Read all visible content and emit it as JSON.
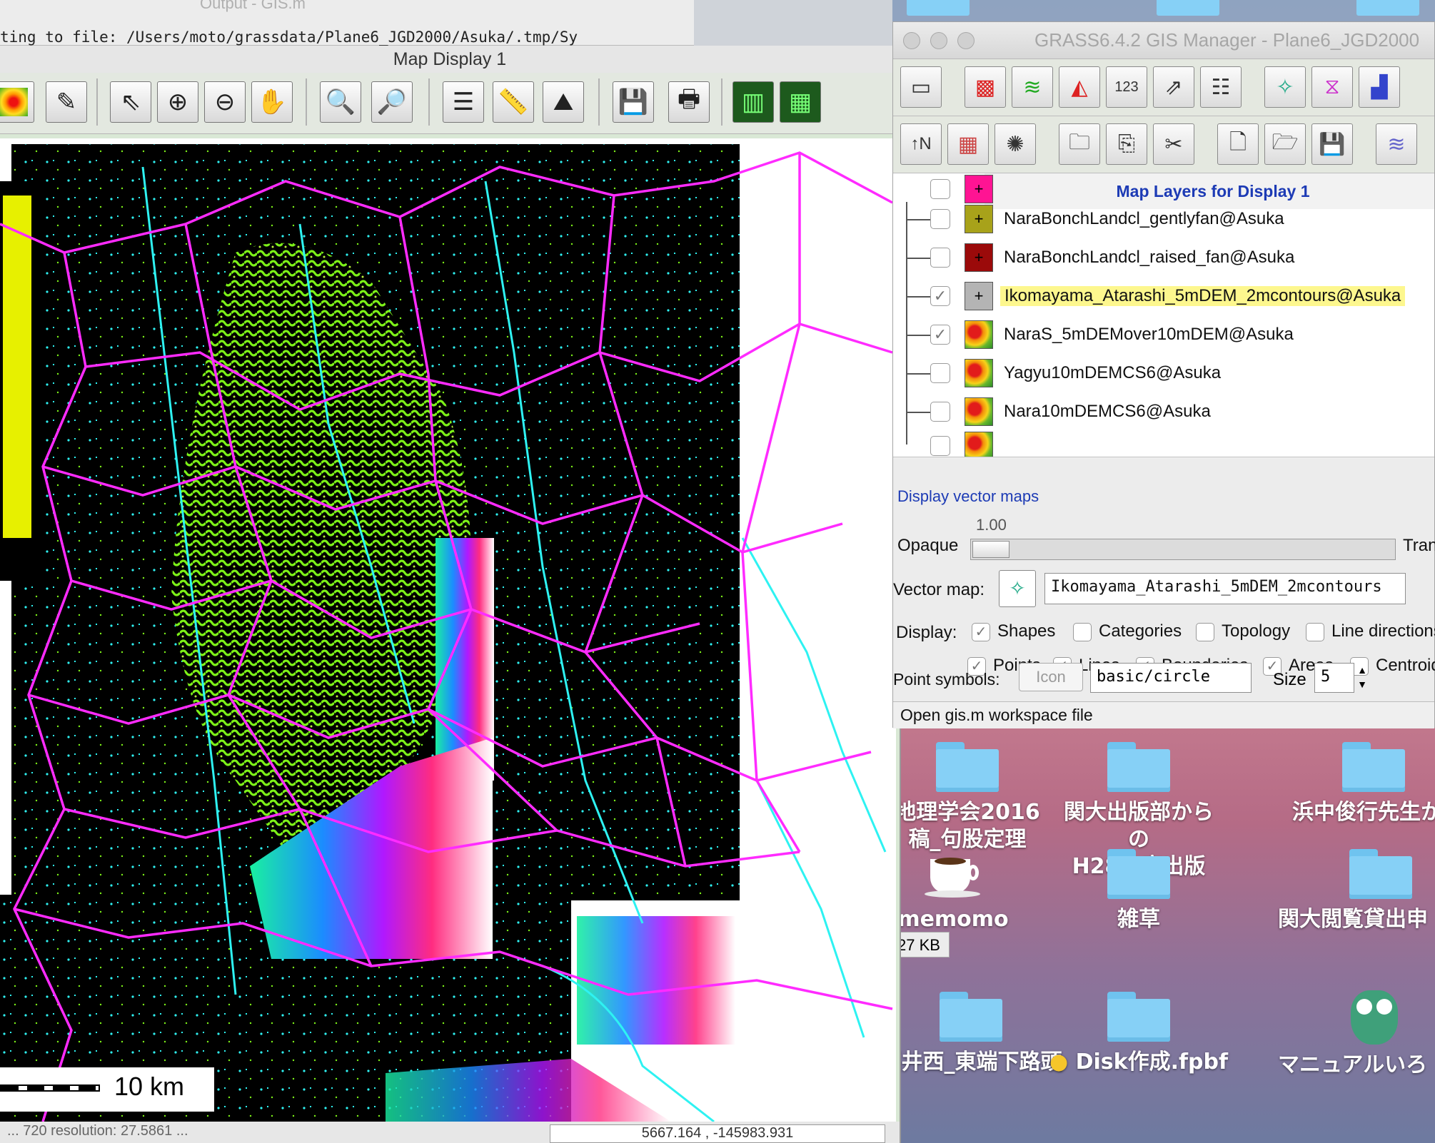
{
  "output_window": {
    "title": "Output - GIS.m",
    "text": "ting to file: /Users/moto/grassdata/Plane6_JGD2000/Asuka/.tmp/Sy"
  },
  "map_display": {
    "title": "Map Display 1",
    "scale_label": "10  km",
    "status_left": "...  720    resolution: 27.5861 ...",
    "coords": "5667.164 ,  -145983.931"
  },
  "gis_manager": {
    "title": "GRASS6.4.2 GIS Manager - Plane6_JGD2000",
    "layers_header": "Map Layers for Display 1",
    "layers": [
      {
        "name": "",
        "checked": false,
        "symbol": "magenta-cross",
        "color": "#ff1493"
      },
      {
        "name": "NaraBonchLandcl_gentlyfan@Asuka",
        "checked": false,
        "symbol": "olive-cross",
        "color": "#a8a21a"
      },
      {
        "name": "NaraBonchLandcl_raised_fan@Asuka",
        "checked": false,
        "symbol": "darkred-cross",
        "color": "#9b0a0a"
      },
      {
        "name": "Ikomayama_Atarashi_5mDEM_2mcontours@Asuka",
        "checked": true,
        "selected": true,
        "symbol": "gray-cross",
        "color": "#b4b4b4"
      },
      {
        "name": "NaraS_5mDEMover10mDEM@Asuka",
        "checked": true,
        "symbol": "raster-icon"
      },
      {
        "name": "Yagyu10mDEMCS6@Asuka",
        "checked": false,
        "symbol": "raster-icon"
      },
      {
        "name": "Nara10mDEMCS6@Asuka",
        "checked": false,
        "symbol": "raster-icon"
      },
      {
        "name": "",
        "checked": false,
        "symbol": "raster-icon"
      }
    ],
    "options": {
      "display_vector_link": "Display vector maps",
      "opaque_label": "Opaque",
      "opacity_value": "1.00",
      "opacity_fraction": 0.0,
      "transparent_label": "Tran",
      "vector_map_label": "Vector map:",
      "vector_map_value": "Ikomayama_Atarashi_5mDEM_2mcontours",
      "display_label": "Display:",
      "display_checks": [
        {
          "label": "Shapes",
          "checked": true
        },
        {
          "label": "Categories",
          "checked": false
        },
        {
          "label": "Topology",
          "checked": false
        },
        {
          "label": "Line directions",
          "checked": false
        }
      ],
      "element_checks": [
        {
          "label": "Points",
          "checked": true
        },
        {
          "label": "Lines",
          "checked": true
        },
        {
          "label": "Boundaries",
          "checked": true
        },
        {
          "label": "Areas",
          "checked": true
        },
        {
          "label": "Centroids",
          "checked": false
        }
      ],
      "point_symbols_label": "Point symbols:",
      "icon_button": "Icon",
      "symbol_value": "basic/circle",
      "size_label": "Size",
      "size_value": "5"
    },
    "status": "Open gis.m workspace file"
  },
  "desktop": {
    "size_tag": "27 KB",
    "items": [
      {
        "label_line1": "地理学会2016",
        "label_line2": "稿_句股定理",
        "kind": "folder"
      },
      {
        "label_line1": "関大出版部からの",
        "label_line2": "H28年度出版",
        "kind": "folder"
      },
      {
        "label_line1": "浜中俊行先生か",
        "label_line2": "",
        "kind": "folder"
      },
      {
        "label_line1": "memomo",
        "label_line2": "",
        "kind": "coffee-cup-icon"
      },
      {
        "label_line1": "雑草",
        "label_line2": "",
        "kind": "folder"
      },
      {
        "label_line1": "関大閲覧貸出申",
        "label_line2": "",
        "kind": "folder"
      },
      {
        "label_line1": "福井西_東端下路頭",
        "label_line2": "",
        "kind": "folder"
      },
      {
        "label_line1": "Disk作成.fpbf",
        "label_line2": "",
        "kind": "disk-folder"
      },
      {
        "label_line1": "マニュアルいろ",
        "label_line2": "",
        "kind": "owl-icon"
      }
    ]
  },
  "colors": {
    "boundary": "#ff2bff",
    "stream": "#2ef2f2",
    "terrain_green": "#7df218",
    "terrain_black": "#000000"
  }
}
